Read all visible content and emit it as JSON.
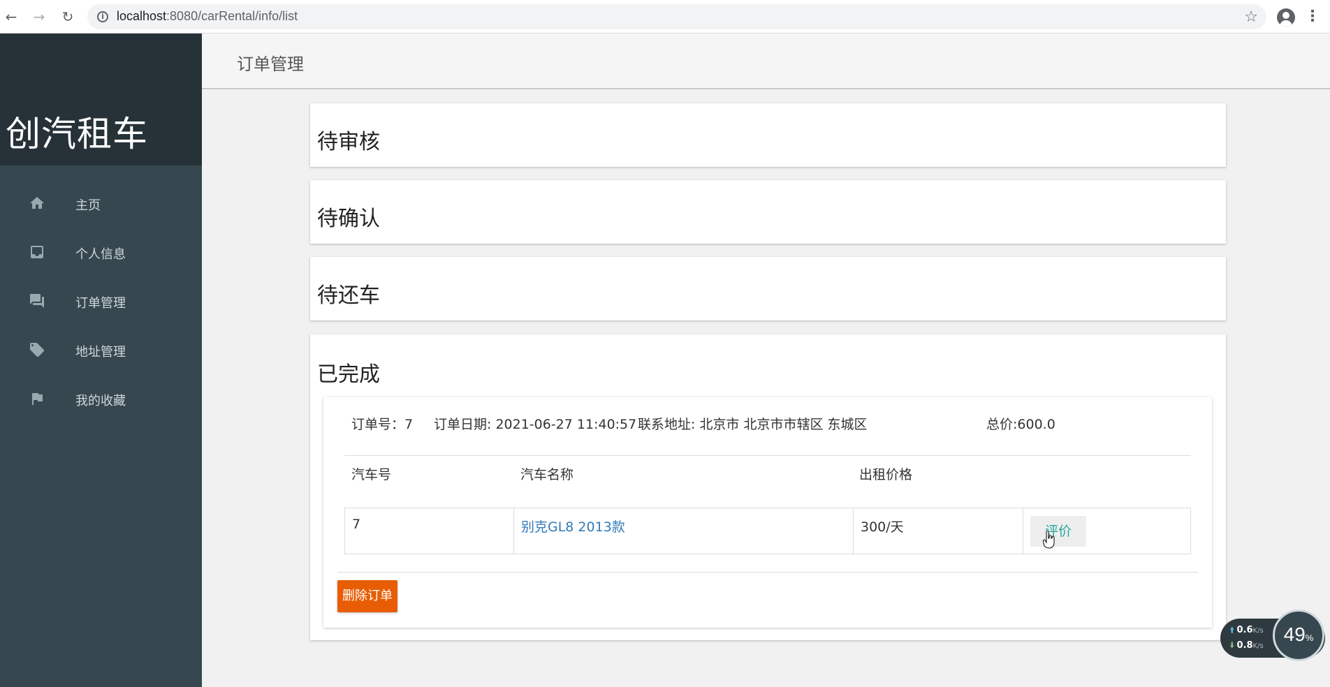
{
  "browser": {
    "url_host": "localhost",
    "url_path": ":8080/carRental/info/list"
  },
  "sidebar": {
    "brand": "创汽租车",
    "items": [
      {
        "label": "主页",
        "icon": "home-icon"
      },
      {
        "label": "个人信息",
        "icon": "inbox-icon"
      },
      {
        "label": "订单管理",
        "icon": "forum-icon"
      },
      {
        "label": "地址管理",
        "icon": "tag-icon"
      },
      {
        "label": "我的收藏",
        "icon": "flag-icon"
      }
    ]
  },
  "header": {
    "title": "订单管理"
  },
  "sections": [
    {
      "title": "待审核"
    },
    {
      "title": "待确认"
    },
    {
      "title": "待还车"
    },
    {
      "title": "已完成"
    }
  ],
  "order": {
    "number_label": "订单号：7",
    "date_label": "订单日期: 2021-06-27 11:40:57",
    "address_label": "联系地址: 北京市 北京市市辖区 东城区",
    "total_label": "总价:600.0",
    "columns": [
      "汽车号",
      "汽车名称",
      "出租价格"
    ],
    "rows": [
      {
        "car_id": "7",
        "car_name": "别克GL8 2013款",
        "price": "300/天",
        "action": "评价"
      }
    ],
    "delete_label": "删除订单"
  },
  "net_widget": {
    "upload": "0.6",
    "download": "0.8",
    "unit": "K/s",
    "percent": "49",
    "percent_unit": "%"
  },
  "colors": {
    "sidebar": "#37474f",
    "brand_bg": "#263238",
    "link": "#337ab7",
    "review": "#26a69a",
    "delete": "#e85d04"
  }
}
